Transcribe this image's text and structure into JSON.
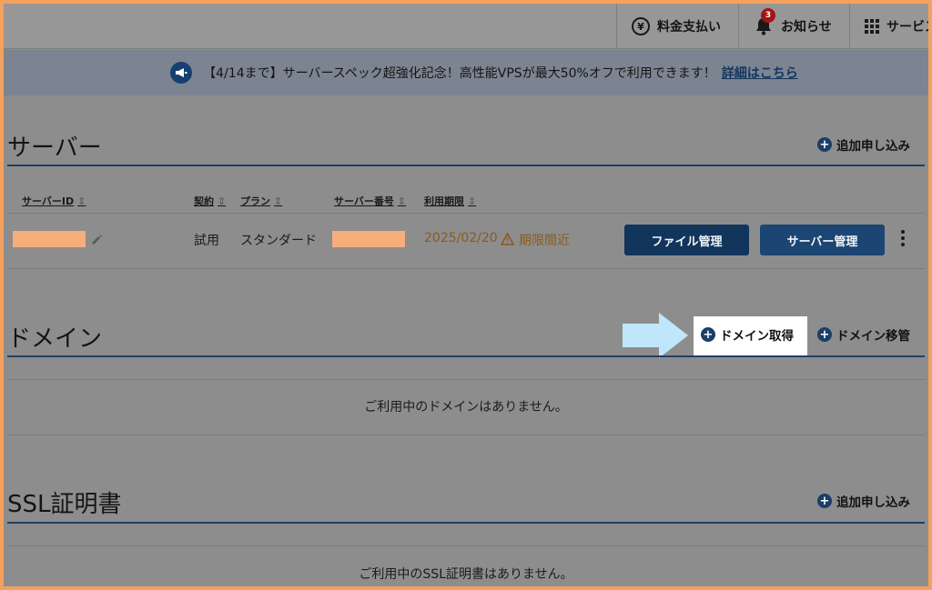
{
  "topbar": {
    "billing_label": "料金支払い",
    "billing_icon": "yen-icon",
    "notice_label": "お知らせ",
    "notice_count": "3",
    "services_label": "サービス"
  },
  "banner": {
    "text": "【4/14まで】サーバースペック超強化記念！高性能VPSが最大50%オフで利用できます！",
    "link": "詳細はこちら"
  },
  "server": {
    "title": "サーバー",
    "add_label": "追加申し込み",
    "columns": [
      "サーバーID",
      "契約",
      "プラン",
      "サーバー番号",
      "利用期限"
    ],
    "row": {
      "contract": "試用",
      "plan": "スタンダード",
      "expiry": "2025/02/20",
      "expiry_warning": "期限間近"
    },
    "file_button": "ファイル管理",
    "manage_button": "サーバー管理"
  },
  "domain": {
    "title": "ドメイン",
    "get_label": "ドメイン取得",
    "transfer_label": "ドメイン移管",
    "empty": "ご利用中のドメインはありません。"
  },
  "ssl": {
    "title": "SSL証明書",
    "add_label": "追加申し込み",
    "empty": "ご利用中のSSL証明書はありません。"
  },
  "colors": {
    "frame_border": "#f3a15f",
    "primary": "#1b3e66",
    "highlight_arrow": "#bfe6fb"
  }
}
